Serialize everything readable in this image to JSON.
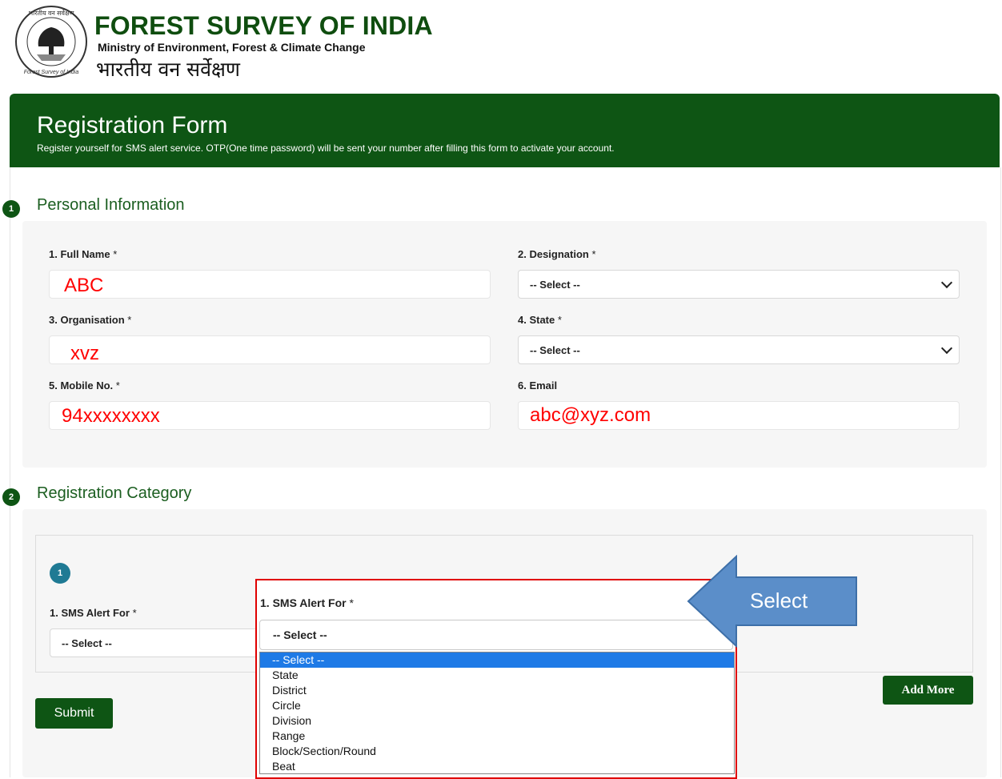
{
  "header": {
    "org_title": "FOREST SURVEY OF INDIA",
    "org_subtitle": "Ministry of Environment, Forest & Climate Change",
    "org_hindi": "भारतीय वन सर्वेक्षण",
    "logo_text_top": "भारतीय वन सर्वेक्षण",
    "logo_text_bottom": "Forest Survey of India"
  },
  "banner": {
    "title": "Registration Form",
    "description": "Register yourself for SMS alert service. OTP(One time password) will be sent your number after filling this form to activate your account."
  },
  "section1": {
    "number": "1",
    "title": "Personal Information",
    "fields": {
      "full_name": {
        "label": "1. Full Name",
        "value": "ABC"
      },
      "designation": {
        "label": "2. Designation",
        "value": "-- Select --"
      },
      "organisation": {
        "label": "3. Organisation",
        "value": "xvz"
      },
      "state": {
        "label": "4. State",
        "value": "-- Select --"
      },
      "mobile": {
        "label": "5. Mobile No.",
        "value": "94xxxxxxxx"
      },
      "email": {
        "label": "6. Email",
        "value": "abc@xyz.com"
      }
    },
    "required_mark": "*"
  },
  "section2": {
    "number": "2",
    "title": "Registration Category",
    "entry_number": "1",
    "sms_alert_label": "1. SMS Alert For",
    "sms_alert_value": "-- Select --",
    "add_more_label": "Add More",
    "submit_label": "Submit"
  },
  "dropdown_overlay": {
    "label": "1. SMS Alert For",
    "selected": "-- Select --",
    "options": [
      "-- Select --",
      "State",
      "District",
      "Circle",
      "Division",
      "Range",
      "Block/Section/Round",
      "Beat"
    ]
  },
  "callout": {
    "text": "Select",
    "color": "#5b8ec9"
  },
  "colors": {
    "primary_green": "#0e5514",
    "annotation_red": "#e00000",
    "highlight_blue": "#1e7ae6"
  }
}
